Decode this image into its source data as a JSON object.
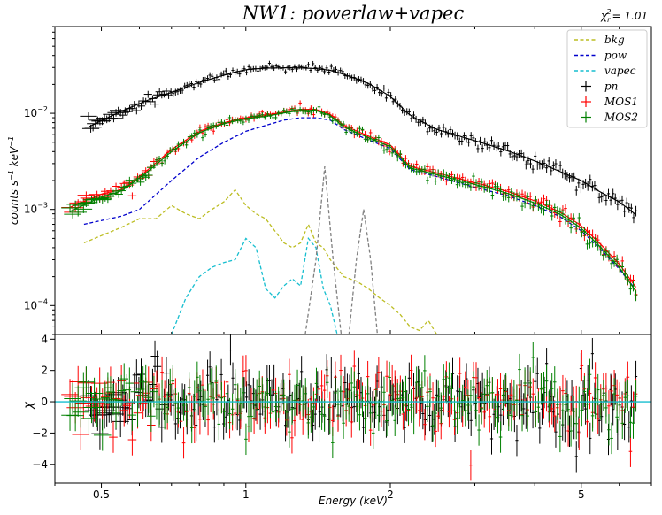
{
  "chart_data": {
    "type": "scatter",
    "title": "NW1: powerlaw+vapec",
    "fit_statistic": {
      "symbol": "χ",
      "subscript": "r",
      "superscript": "2",
      "value_text": "= 1.01"
    },
    "x_axis": {
      "label": "Energy (keV)",
      "scale": "log",
      "range": [
        0.4,
        7.0
      ],
      "ticks": [
        {
          "value": 0.5,
          "label": "0.5"
        },
        {
          "value": 1,
          "label": "1"
        },
        {
          "value": 2,
          "label": "2"
        },
        {
          "value": 5,
          "label": "5"
        }
      ]
    },
    "top_panel": {
      "ylabel_main": "counts s",
      "ylabel_exp1": "−1",
      "ylabel_mid": " keV",
      "ylabel_exp2": "−1",
      "y_scale": "log",
      "y_range": [
        5e-05,
        0.08
      ],
      "y_ticks": [
        {
          "value": 0.01,
          "base": "10",
          "exp": "−2"
        },
        {
          "value": 0.001,
          "base": "10",
          "exp": "−3"
        },
        {
          "value": 0.0001,
          "base": "10",
          "exp": "−4"
        }
      ]
    },
    "bottom_panel": {
      "ylabel": "χ",
      "y_range": [
        -5.2,
        4.3
      ],
      "y_ticks": [
        {
          "value": 4,
          "label": "4"
        },
        {
          "value": 2,
          "label": "2"
        },
        {
          "value": 0,
          "label": "0"
        },
        {
          "value": -2,
          "label": "−2"
        },
        {
          "value": -4,
          "label": "−4"
        }
      ],
      "zero_line_color": "#17becf"
    },
    "legend": {
      "location": "upper right",
      "entries": [
        {
          "label": "bkg",
          "style": "dashed",
          "color": "#bcbd22"
        },
        {
          "label": "pow",
          "style": "dashed",
          "color": "#0000cc"
        },
        {
          "label": "vapec",
          "style": "dashed",
          "color": "#17becf"
        },
        {
          "label": "pn",
          "style": "cross",
          "color": "#000000"
        },
        {
          "label": "MOS1",
          "style": "cross",
          "color": "#ff0000"
        },
        {
          "label": "MOS2",
          "style": "cross",
          "color": "#008000"
        }
      ]
    },
    "data_series": [
      {
        "name": "pn",
        "color": "#000000",
        "sample_points": [
          [
            0.47,
            0.0072
          ],
          [
            0.55,
            0.0105
          ],
          [
            0.62,
            0.0135
          ],
          [
            0.7,
            0.0165
          ],
          [
            0.8,
            0.021
          ],
          [
            0.9,
            0.025
          ],
          [
            1.0,
            0.0285
          ],
          [
            1.1,
            0.0295
          ],
          [
            1.2,
            0.0298
          ],
          [
            1.3,
            0.0297
          ],
          [
            1.4,
            0.0292
          ],
          [
            1.5,
            0.028
          ],
          [
            1.6,
            0.0255
          ],
          [
            1.8,
            0.0205
          ],
          [
            2.0,
            0.015
          ],
          [
            2.2,
            0.0095
          ],
          [
            2.5,
            0.0068
          ],
          [
            3.0,
            0.0052
          ],
          [
            3.5,
            0.0041
          ],
          [
            4.0,
            0.0032
          ],
          [
            4.5,
            0.0025
          ],
          [
            5.0,
            0.002
          ],
          [
            5.5,
            0.0015
          ],
          [
            6.0,
            0.0012
          ],
          [
            6.5,
            0.00088
          ]
        ]
      },
      {
        "name": "MOS1",
        "color": "#ff0000",
        "sample_points": [
          [
            0.43,
            0.00105
          ],
          [
            0.5,
            0.00145
          ],
          [
            0.55,
            0.0016
          ],
          [
            0.62,
            0.0025
          ],
          [
            0.7,
            0.0042
          ],
          [
            0.8,
            0.0065
          ],
          [
            0.9,
            0.008
          ],
          [
            1.0,
            0.009
          ],
          [
            1.1,
            0.0095
          ],
          [
            1.2,
            0.0103
          ],
          [
            1.3,
            0.011
          ],
          [
            1.4,
            0.011
          ],
          [
            1.5,
            0.0098
          ],
          [
            1.6,
            0.0075
          ],
          [
            1.8,
            0.0058
          ],
          [
            2.0,
            0.0047
          ],
          [
            2.2,
            0.0028
          ],
          [
            2.5,
            0.0024
          ],
          [
            3.0,
            0.0019
          ],
          [
            3.5,
            0.00155
          ],
          [
            4.0,
            0.00123
          ],
          [
            4.5,
            0.00095
          ],
          [
            5.0,
            0.00068
          ],
          [
            5.5,
            0.00043
          ],
          [
            6.0,
            0.00027
          ],
          [
            6.5,
            0.000155
          ]
        ]
      },
      {
        "name": "MOS2",
        "color": "#008000",
        "sample_points": [
          [
            0.43,
            0.00095
          ],
          [
            0.5,
            0.00135
          ],
          [
            0.55,
            0.00155
          ],
          [
            0.62,
            0.0024
          ],
          [
            0.7,
            0.004
          ],
          [
            0.8,
            0.0063
          ],
          [
            0.9,
            0.0078
          ],
          [
            1.0,
            0.0088
          ],
          [
            1.1,
            0.0093
          ],
          [
            1.2,
            0.0101
          ],
          [
            1.3,
            0.0107
          ],
          [
            1.4,
            0.0107
          ],
          [
            1.5,
            0.0095
          ],
          [
            1.6,
            0.0072
          ],
          [
            1.8,
            0.0056
          ],
          [
            2.0,
            0.0045
          ],
          [
            2.2,
            0.0027
          ],
          [
            2.5,
            0.0023
          ],
          [
            3.0,
            0.00182
          ],
          [
            3.5,
            0.00148
          ],
          [
            4.0,
            0.00117
          ],
          [
            4.5,
            0.0009
          ],
          [
            5.0,
            0.00064
          ],
          [
            5.5,
            0.0004
          ],
          [
            6.0,
            0.00025
          ],
          [
            6.5,
            0.00014
          ]
        ]
      }
    ],
    "model_curves": [
      {
        "name": "pow",
        "color": "#0000cc",
        "style": "dashed",
        "points": [
          [
            0.46,
            0.0007
          ],
          [
            0.55,
            0.00085
          ],
          [
            0.6,
            0.001
          ],
          [
            0.7,
            0.002
          ],
          [
            0.8,
            0.0035
          ],
          [
            0.9,
            0.005
          ],
          [
            1.0,
            0.0065
          ],
          [
            1.1,
            0.0075
          ],
          [
            1.2,
            0.0085
          ],
          [
            1.3,
            0.009
          ],
          [
            1.4,
            0.009
          ],
          [
            1.5,
            0.0085
          ],
          [
            1.6,
            0.0068
          ],
          [
            1.8,
            0.0053
          ],
          [
            2.0,
            0.0043
          ],
          [
            2.2,
            0.0026
          ],
          [
            2.5,
            0.0022
          ],
          [
            3.0,
            0.0017
          ],
          [
            3.5,
            0.0014
          ],
          [
            4.0,
            0.0011
          ],
          [
            4.5,
            0.00085
          ],
          [
            5.0,
            0.0006
          ],
          [
            5.5,
            0.00038
          ],
          [
            6.0,
            0.00024
          ],
          [
            6.4,
            0.00016
          ]
        ]
      },
      {
        "name": "bkg",
        "color": "#bcbd22",
        "style": "dashed",
        "points": [
          [
            0.46,
            0.00045
          ],
          [
            0.55,
            0.00065
          ],
          [
            0.6,
            0.0008
          ],
          [
            0.65,
            0.0008
          ],
          [
            0.7,
            0.0011
          ],
          [
            0.75,
            0.0009
          ],
          [
            0.8,
            0.0008
          ],
          [
            0.85,
            0.001
          ],
          [
            0.9,
            0.0012
          ],
          [
            0.95,
            0.0016
          ],
          [
            1.0,
            0.0011
          ],
          [
            1.05,
            0.0009
          ],
          [
            1.1,
            0.0008
          ],
          [
            1.2,
            0.00045
          ],
          [
            1.25,
            0.0004
          ],
          [
            1.3,
            0.00045
          ],
          [
            1.35,
            0.0007
          ],
          [
            1.4,
            0.00045
          ],
          [
            1.45,
            0.0004
          ],
          [
            1.5,
            0.0003
          ],
          [
            1.6,
            0.0002
          ],
          [
            1.7,
            0.00018
          ],
          [
            1.8,
            0.00015
          ],
          [
            1.9,
            0.00012
          ],
          [
            2.0,
            0.0001
          ],
          [
            2.1,
            8e-05
          ],
          [
            2.2,
            6e-05
          ],
          [
            2.3,
            5.5e-05
          ],
          [
            2.4,
            7e-05
          ],
          [
            2.5,
            5e-05
          ]
        ]
      },
      {
        "name": "vapec",
        "color": "#17becf",
        "style": "dashed",
        "points": [
          [
            0.7,
            5e-05
          ],
          [
            0.75,
            0.00012
          ],
          [
            0.8,
            0.0002
          ],
          [
            0.85,
            0.00025
          ],
          [
            0.9,
            0.00028
          ],
          [
            0.95,
            0.0003
          ],
          [
            1.0,
            0.0005
          ],
          [
            1.05,
            0.0004
          ],
          [
            1.1,
            0.00015
          ],
          [
            1.15,
            0.00012
          ],
          [
            1.2,
            0.00016
          ],
          [
            1.25,
            0.00019
          ],
          [
            1.3,
            0.00016
          ],
          [
            1.35,
            0.0005
          ],
          [
            1.4,
            0.0004
          ],
          [
            1.45,
            0.00015
          ],
          [
            1.5,
            0.0001
          ],
          [
            1.55,
            5e-05
          ]
        ]
      },
      {
        "name": "gaussian-line",
        "color": "#808080",
        "style": "dashed",
        "points": [
          [
            1.33,
            5e-05
          ],
          [
            1.4,
            0.0003
          ],
          [
            1.46,
            0.0028
          ],
          [
            1.52,
            0.0003
          ],
          [
            1.58,
            5e-05
          ],
          [
            1.64,
            5e-05
          ],
          [
            1.7,
            0.0003
          ],
          [
            1.76,
            0.001
          ],
          [
            1.82,
            0.0003
          ],
          [
            1.88,
            5e-05
          ]
        ]
      }
    ]
  }
}
